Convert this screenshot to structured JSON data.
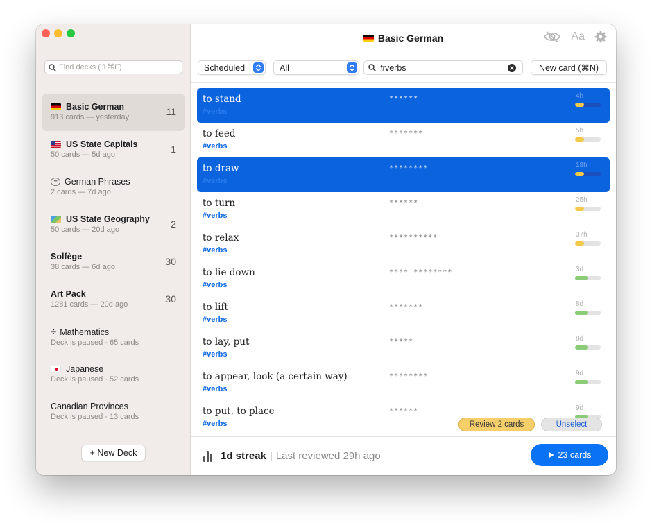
{
  "window": {
    "title": "Basic German",
    "title_flag": "flag-de"
  },
  "sidebar": {
    "search_placeholder": "Find decks (⇧⌘F)",
    "decks": [
      {
        "icon": "flag-de",
        "name": "Basic German",
        "bold": true,
        "sub": "913 cards — yesterday",
        "count": "11",
        "selected": true
      },
      {
        "icon": "flag-us",
        "name": "US State Capitals",
        "bold": true,
        "sub": "50 cards — 5d ago",
        "count": "1",
        "selected": false
      },
      {
        "icon": "speech-bubble-icon",
        "name": "German Phrases",
        "bold": false,
        "sub": "2 cards — 7d ago",
        "count": "",
        "selected": false
      },
      {
        "icon": "map-icon",
        "name": "US State Geography",
        "bold": true,
        "sub": "50 cards — 20d ago",
        "count": "2",
        "selected": false
      },
      {
        "icon": "",
        "name": "Solfège",
        "bold": true,
        "sub": "38 cards — 6d ago",
        "count": "30",
        "selected": false
      },
      {
        "icon": "",
        "name": "Art Pack",
        "bold": true,
        "sub": "1281 cards — 20d ago",
        "count": "30",
        "selected": false
      },
      {
        "icon": "division-icon",
        "name": "Mathematics",
        "bold": false,
        "sub": "Deck is paused · 65 cards",
        "count": "",
        "selected": false
      },
      {
        "icon": "flag-jp",
        "name": "Japanese",
        "bold": false,
        "sub": "Deck is paused · 52 cards",
        "count": "",
        "selected": false
      },
      {
        "icon": "",
        "name": "Canadian Provinces",
        "bold": false,
        "sub": "Deck is paused · 13 cards",
        "count": "",
        "selected": false
      }
    ],
    "new_deck_label": "+ New Deck"
  },
  "toolbar": {
    "filter_selected": "Scheduled",
    "scope_selected": "All",
    "search_value": "#verbs",
    "new_card_label": "New card (⌘N)"
  },
  "colors": {
    "accent": "#0a72f5",
    "selection": "#0b63de",
    "tag": "#0b66e4",
    "due_yellow": "#f3c94a",
    "due_green": "#8ccc78"
  },
  "cards": [
    {
      "front": "to stand",
      "tag": "#verbs",
      "back": "******",
      "due": "4h",
      "progress": 0.35,
      "fill": "yellow",
      "selected": true
    },
    {
      "front": "to feed",
      "tag": "#verbs",
      "back": "*******",
      "due": "5h",
      "progress": 0.35,
      "fill": "yellow",
      "selected": false
    },
    {
      "front": "to draw",
      "tag": "#verbs",
      "back": "********",
      "due": "18h",
      "progress": 0.35,
      "fill": "yellow",
      "selected": true
    },
    {
      "front": "to turn",
      "tag": "#verbs",
      "back": "******",
      "due": "25h",
      "progress": 0.35,
      "fill": "yellow",
      "selected": false
    },
    {
      "front": "to relax",
      "tag": "#verbs",
      "back": "**********",
      "due": "37h",
      "progress": 0.35,
      "fill": "yellow",
      "selected": false
    },
    {
      "front": "to lie down",
      "tag": "#verbs",
      "back": "**** ********",
      "due": "3d",
      "progress": 0.5,
      "fill": "green",
      "selected": false
    },
    {
      "front": "to lift",
      "tag": "#verbs",
      "back": "*******",
      "due": "8d",
      "progress": 0.5,
      "fill": "green",
      "selected": false
    },
    {
      "front": "to lay, put",
      "tag": "#verbs",
      "back": "*****",
      "due": "8d",
      "progress": 0.5,
      "fill": "green",
      "selected": false
    },
    {
      "front": "to appear, look (a certain way)",
      "tag": "#verbs",
      "back": "********",
      "due": "9d",
      "progress": 0.5,
      "fill": "green",
      "selected": false
    },
    {
      "front": "to put, to place",
      "tag": "#verbs",
      "back": "******",
      "due": "9d",
      "progress": 0.5,
      "fill": "green",
      "selected": false
    }
  ],
  "selection_actions": {
    "review_label": "Review 2 cards",
    "unselect_label": "Unselect"
  },
  "footer": {
    "streak_bold": "1d streak",
    "separator": "|",
    "streak_rest": "Last reviewed 29h ago",
    "study_label": "23 cards"
  }
}
